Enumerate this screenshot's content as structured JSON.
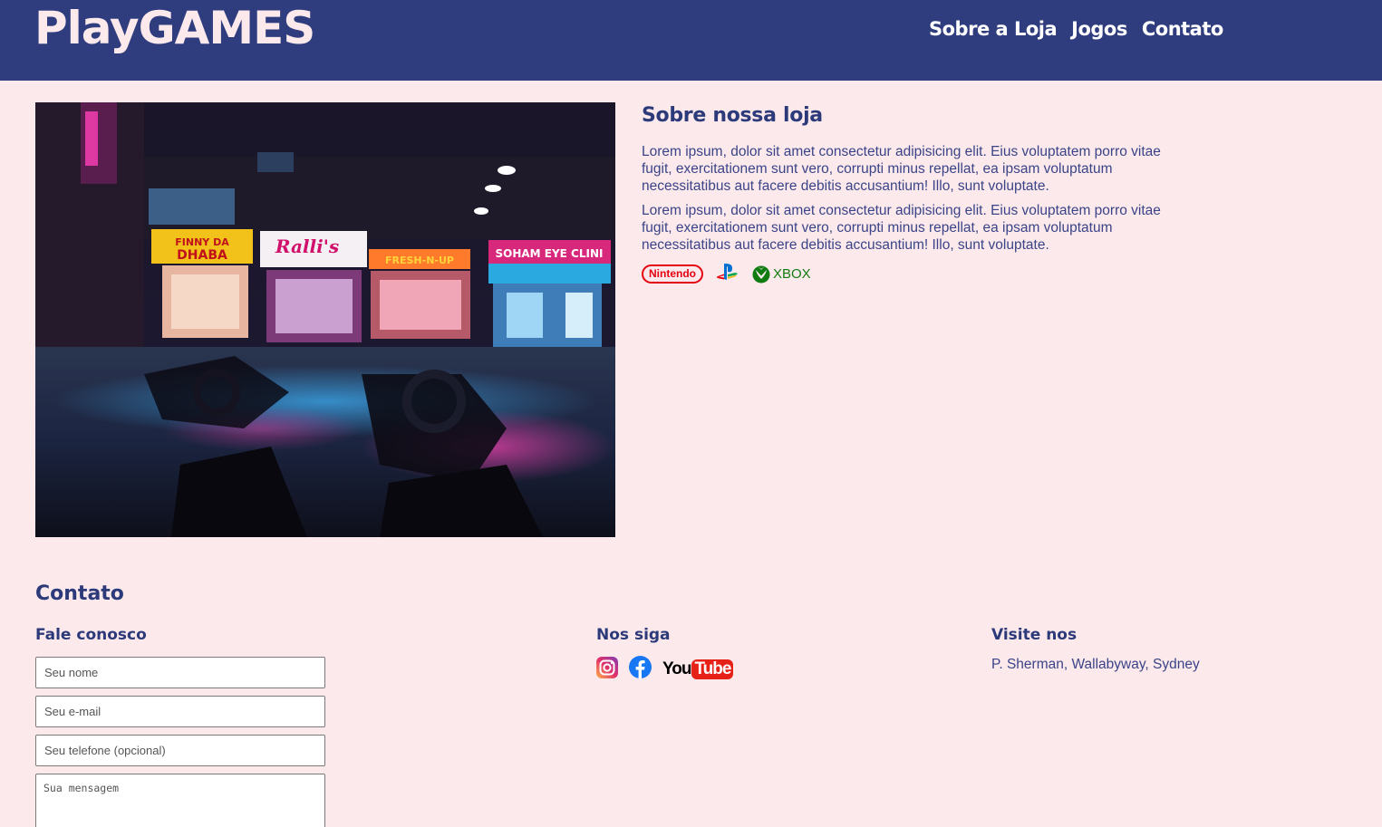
{
  "header": {
    "logo": "PlayGAMES",
    "nav": [
      "Sobre a Loja",
      "Jogos",
      "Contato"
    ]
  },
  "about": {
    "title": "Sobre nossa loja",
    "paragraphs": [
      "Lorem ipsum, dolor sit amet consectetur adipisicing elit. Eius voluptatem porro vitae fugit, exercitationem sunt vero, corrupti minus repellat, ea ipsam voluptatum necessitatibus aut facere debitis accusantium! Illo, sunt voluptate.",
      "Lorem ipsum, dolor sit amet consectetur adipisicing elit. Eius voluptatem porro vitae fugit, exercitationem sunt vero, corrupti minus repellat, ea ipsam voluptatum necessitatibus aut facere debitis accusantium! Illo, sunt voluptate."
    ],
    "brands": {
      "nintendo": "Nintendo",
      "playstation": "playstation-icon",
      "xbox": "XBOX"
    },
    "image_signs": [
      "FINNY DA DHABA",
      "Ralli's",
      "FRESH-N-UP",
      "SOHAM EYE CLINI"
    ]
  },
  "contact": {
    "title": "Contato",
    "form": {
      "title": "Fale conosco",
      "name_placeholder": "Seu nome",
      "email_placeholder": "Seu e-mail",
      "phone_placeholder": "Seu telefone (opcional)",
      "message_placeholder": "Sua mensagem"
    },
    "follow": {
      "title": "Nos siga",
      "youtube_you": "You",
      "youtube_tube": "Tube"
    },
    "visit": {
      "title": "Visite nos",
      "address": "P. Sherman, Wallabyway, Sydney"
    }
  },
  "colors": {
    "header_bg": "#2f3c7e",
    "page_bg": "#fbe9eb",
    "accent_text": "#2d3a7a"
  }
}
